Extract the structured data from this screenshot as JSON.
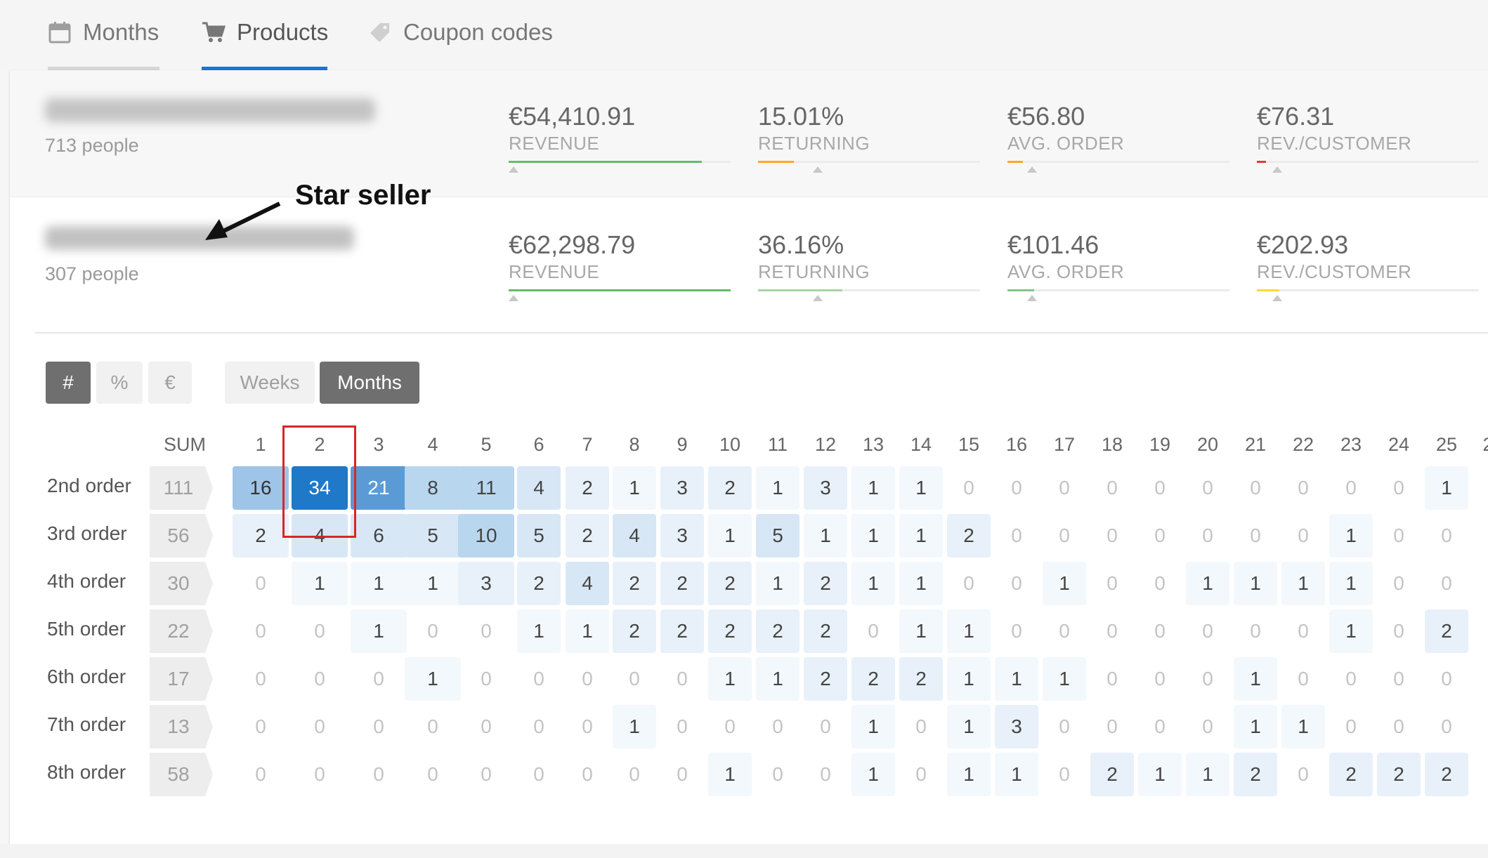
{
  "tabs": [
    {
      "label": "Months",
      "icon": "calendar-icon",
      "active": false
    },
    {
      "label": "Products",
      "icon": "cart-icon",
      "active": true
    },
    {
      "label": "Coupon codes",
      "icon": "tag-icon",
      "active": false
    }
  ],
  "products": [
    {
      "name": "",
      "people": "713 people",
      "metrics": [
        {
          "value": "€54,410.91",
          "label": "REVENUE",
          "fill_fraction": 0.87,
          "color": "#66bb6a"
        },
        {
          "value": "15.01%",
          "label": "RETURNING",
          "fill_fraction": 0.16,
          "color": "#ffa726"
        },
        {
          "value": "€56.80",
          "label": "AVG. ORDER",
          "fill_fraction": 0.07,
          "color": "#ffa726"
        },
        {
          "value": "€76.31",
          "label": "REV./CUSTOMER",
          "fill_fraction": 0.04,
          "color": "#e53935"
        }
      ]
    },
    {
      "name": "",
      "people": "307 people",
      "metrics": [
        {
          "value": "€62,298.79",
          "label": "REVENUE",
          "fill_fraction": 1.0,
          "color": "#66bb6a"
        },
        {
          "value": "36.16%",
          "label": "RETURNING",
          "fill_fraction": 0.38,
          "color": "#a5d6a7"
        },
        {
          "value": "€101.46",
          "label": "AVG. ORDER",
          "fill_fraction": 0.12,
          "color": "#81c784"
        },
        {
          "value": "€202.93",
          "label": "REV./CUSTOMER",
          "fill_fraction": 0.1,
          "color": "#fdd835"
        }
      ]
    }
  ],
  "annotation": {
    "text": "Star seller"
  },
  "value_toggles": [
    {
      "label": "#",
      "active": true
    },
    {
      "label": "%",
      "active": false
    },
    {
      "label": "€",
      "active": false
    }
  ],
  "period_toggles": [
    {
      "label": "Weeks",
      "active": false
    },
    {
      "label": "Months",
      "active": true
    }
  ],
  "table": {
    "sum_header": "SUM",
    "columns": [
      "1",
      "2",
      "3",
      "4",
      "5",
      "6",
      "7",
      "8",
      "9",
      "10",
      "11",
      "12",
      "13",
      "14",
      "15",
      "16",
      "17",
      "18",
      "19",
      "20",
      "21",
      "22",
      "23",
      "24",
      "25",
      "2"
    ],
    "rows": [
      {
        "label": "2nd order",
        "sum": "111",
        "values": [
          16,
          34,
          21,
          8,
          11,
          4,
          2,
          1,
          3,
          2,
          1,
          3,
          1,
          1,
          0,
          0,
          0,
          0,
          0,
          0,
          0,
          0,
          0,
          0,
          1
        ]
      },
      {
        "label": "3rd order",
        "sum": "56",
        "values": [
          2,
          4,
          6,
          5,
          10,
          5,
          2,
          4,
          3,
          1,
          5,
          1,
          1,
          1,
          2,
          0,
          0,
          0,
          0,
          0,
          0,
          0,
          1,
          0,
          0
        ]
      },
      {
        "label": "4th order",
        "sum": "30",
        "values": [
          0,
          1,
          1,
          1,
          3,
          2,
          4,
          2,
          2,
          2,
          1,
          2,
          1,
          1,
          0,
          0,
          1,
          0,
          0,
          1,
          1,
          1,
          1,
          0,
          0
        ]
      },
      {
        "label": "5th order",
        "sum": "22",
        "values": [
          0,
          0,
          1,
          0,
          0,
          1,
          1,
          2,
          2,
          2,
          2,
          2,
          0,
          1,
          1,
          0,
          0,
          0,
          0,
          0,
          0,
          0,
          1,
          0,
          2
        ]
      },
      {
        "label": "6th order",
        "sum": "17",
        "values": [
          0,
          0,
          0,
          1,
          0,
          0,
          0,
          0,
          0,
          1,
          1,
          2,
          2,
          2,
          1,
          1,
          1,
          0,
          0,
          0,
          1,
          0,
          0,
          0,
          0
        ]
      },
      {
        "label": "7th order",
        "sum": "13",
        "values": [
          0,
          0,
          0,
          0,
          0,
          0,
          0,
          1,
          0,
          0,
          0,
          0,
          1,
          0,
          1,
          3,
          0,
          0,
          0,
          0,
          1,
          1,
          0,
          0,
          0
        ]
      },
      {
        "label": "8th order",
        "sum": "58",
        "values": [
          0,
          0,
          0,
          0,
          0,
          0,
          0,
          0,
          0,
          1,
          0,
          0,
          1,
          0,
          1,
          1,
          0,
          2,
          1,
          1,
          2,
          0,
          2,
          2,
          2
        ]
      }
    ],
    "highlighted_column": "2"
  }
}
